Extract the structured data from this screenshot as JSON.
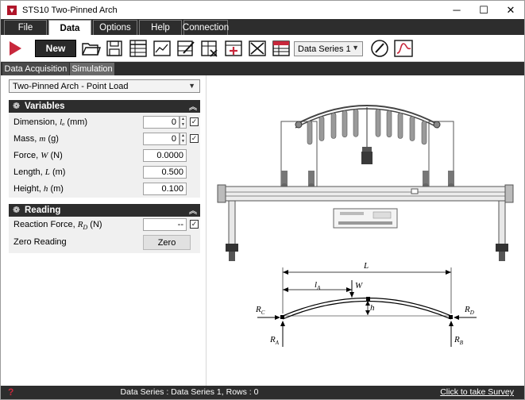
{
  "window": {
    "title": "STS10 Two-Pinned Arch",
    "minimize": "─",
    "maximize": "☐",
    "close": "✕"
  },
  "menu": {
    "tabs": [
      "File",
      "Data",
      "Options",
      "Help",
      "Connection"
    ],
    "active": "Data"
  },
  "toolbar": {
    "new_label": "New",
    "series_select": "Data Series 1"
  },
  "subtabs": {
    "items": [
      "Data Acquisition",
      "Simulation"
    ],
    "active": "Data Acquisition"
  },
  "experiment": {
    "selected": "Two-Pinned Arch - Point Load"
  },
  "variables": {
    "header": "Variables",
    "rows": [
      {
        "label": "Dimension, ",
        "sym": "lₐ",
        "unit": " (mm)",
        "value": "0",
        "spinner": true,
        "checked": true
      },
      {
        "label": "Mass, ",
        "sym": "m",
        "unit": " (g)",
        "value": "0",
        "spinner": true,
        "checked": true
      },
      {
        "label": "Force, ",
        "sym": "W",
        "unit": " (N)",
        "value": "0.0000",
        "spinner": false,
        "checked": false
      },
      {
        "label": "Length, ",
        "sym": "L",
        "unit": " (m)",
        "value": "0.500",
        "spinner": false,
        "checked": false
      },
      {
        "label": "Height, ",
        "sym": "h",
        "unit": " (m)",
        "value": "0.100",
        "spinner": false,
        "checked": false
      }
    ]
  },
  "reading": {
    "header": "Reading",
    "reaction_label": "Reaction Force, ",
    "reaction_sym": "R",
    "reaction_sub": "D",
    "reaction_unit": " (N)",
    "reaction_value": "--",
    "reaction_checked": true,
    "zero_label": "Zero Reading",
    "zero_button": "Zero"
  },
  "diagram": {
    "L": "L",
    "lA": "l",
    "lA_sub": "A",
    "W": "W",
    "h": "h",
    "RC": "R",
    "RC_sub": "C",
    "RD": "R",
    "RD_sub": "D",
    "RA": "R",
    "RA_sub": "A",
    "RB": "R",
    "RB_sub": "B"
  },
  "status": {
    "text": "Data Series : Data Series 1,  Rows : 0",
    "survey": "Click to take Survey",
    "help_icon": "?"
  },
  "colors": {
    "dark": "#2d2d2d",
    "accent_red": "#c8283c",
    "panel": "#f0f0f0"
  }
}
